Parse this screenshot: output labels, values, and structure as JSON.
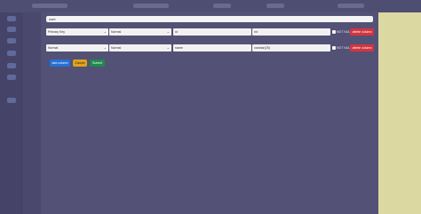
{
  "table_name": "user",
  "columns": [
    {
      "key_type": "Primary Key",
      "type_category": "Normal",
      "column_name": "id",
      "data_type": "int",
      "not_null_label": "NOT NULL",
      "delete_label": "delete column"
    },
    {
      "key_type": "Normal",
      "type_category": "Normal",
      "column_name": "name",
      "data_type": "varchar(25)",
      "not_null_label": "NOT NULL",
      "delete_label": "delete column"
    }
  ],
  "actions": {
    "add_column": "add column",
    "cancel": "Cancel",
    "submit": "Submit"
  },
  "colors": {
    "primary": "#2470d8",
    "warning": "#e0a21a",
    "success": "#1e8a4d",
    "danger": "#d3353f"
  },
  "icons": [
    "chevron-down-icon"
  ]
}
